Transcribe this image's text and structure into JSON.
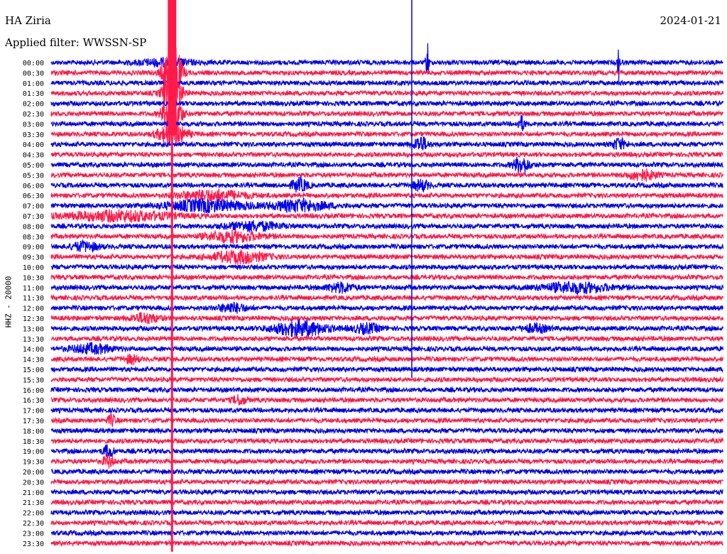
{
  "header": {
    "station": "HA Ziria",
    "date": "2024-01-21",
    "filter_text": "Applied filter: WWSSN-SP"
  },
  "axis": {
    "channel_label": "HHZ - 20000"
  },
  "colors": {
    "series_a": "#0000ee",
    "series_b": "#ff1a4a",
    "text": "#000000",
    "background": "#ffffff"
  },
  "chart_data": {
    "type": "line",
    "title": "HA Ziria",
    "ylabel": "HHZ - 20000",
    "grid": false,
    "row_labels": [
      "00:00",
      "00:30",
      "01:00",
      "01:30",
      "02:00",
      "02:30",
      "03:00",
      "03:30",
      "04:00",
      "04:30",
      "05:00",
      "05:30",
      "06:00",
      "06:30",
      "07:00",
      "07:30",
      "08:00",
      "08:30",
      "09:00",
      "09:30",
      "10:00",
      "10:30",
      "11:00",
      "11:30",
      "12:00",
      "12:30",
      "13:00",
      "13:30",
      "14:00",
      "14:30",
      "15:00",
      "15:30",
      "16:00",
      "16:30",
      "17:00",
      "17:30",
      "18:00",
      "18:30",
      "19:00",
      "19:30",
      "20:00",
      "20:30",
      "21:00",
      "21:30",
      "22:00",
      "22:30",
      "23:00",
      "23:30"
    ],
    "events": [
      {
        "row": 0,
        "x_frac": 0.17,
        "amp": 0.9,
        "width": 0.04
      },
      {
        "row": 0,
        "x_frac": 0.56,
        "amp": 6.0,
        "width": 0.002
      },
      {
        "row": 0,
        "x_frac": 0.845,
        "amp": 5.0,
        "width": 0.002
      },
      {
        "row": 1,
        "x_frac": 0.18,
        "amp": 10.0,
        "width": 0.012
      },
      {
        "row": 3,
        "x_frac": 0.18,
        "amp": 8.0,
        "width": 0.012
      },
      {
        "row": 5,
        "x_frac": 0.18,
        "amp": 8.0,
        "width": 0.012
      },
      {
        "row": 6,
        "x_frac": 0.7,
        "amp": 2.0,
        "width": 0.005
      },
      {
        "row": 7,
        "x_frac": 0.18,
        "amp": 3.0,
        "width": 0.02
      },
      {
        "row": 8,
        "x_frac": 0.55,
        "amp": 2.0,
        "width": 0.01
      },
      {
        "row": 8,
        "x_frac": 0.845,
        "amp": 1.5,
        "width": 0.01
      },
      {
        "row": 10,
        "x_frac": 0.7,
        "amp": 2.2,
        "width": 0.012
      },
      {
        "row": 11,
        "x_frac": 0.88,
        "amp": 1.4,
        "width": 0.02
      },
      {
        "row": 12,
        "x_frac": 0.37,
        "amp": 1.8,
        "width": 0.012
      },
      {
        "row": 12,
        "x_frac": 0.55,
        "amp": 1.4,
        "width": 0.012
      },
      {
        "row": 13,
        "x_frac": 0.24,
        "amp": 1.3,
        "width": 0.05
      },
      {
        "row": 14,
        "x_frac": 0.23,
        "amp": 1.5,
        "width": 0.06
      },
      {
        "row": 14,
        "x_frac": 0.37,
        "amp": 1.5,
        "width": 0.04
      },
      {
        "row": 15,
        "x_frac": 0.1,
        "amp": 1.3,
        "width": 0.08
      },
      {
        "row": 16,
        "x_frac": 0.3,
        "amp": 1.2,
        "width": 0.04
      },
      {
        "row": 17,
        "x_frac": 0.27,
        "amp": 1.4,
        "width": 0.04
      },
      {
        "row": 18,
        "x_frac": 0.05,
        "amp": 1.2,
        "width": 0.02
      },
      {
        "row": 19,
        "x_frac": 0.28,
        "amp": 1.6,
        "width": 0.04
      },
      {
        "row": 22,
        "x_frac": 0.78,
        "amp": 1.3,
        "width": 0.05
      },
      {
        "row": 22,
        "x_frac": 0.43,
        "amp": 1.2,
        "width": 0.02
      },
      {
        "row": 24,
        "x_frac": 0.27,
        "amp": 1.2,
        "width": 0.02
      },
      {
        "row": 25,
        "x_frac": 0.14,
        "amp": 1.3,
        "width": 0.02
      },
      {
        "row": 26,
        "x_frac": 0.37,
        "amp": 2.0,
        "width": 0.04
      },
      {
        "row": 26,
        "x_frac": 0.47,
        "amp": 1.2,
        "width": 0.02
      },
      {
        "row": 26,
        "x_frac": 0.72,
        "amp": 1.0,
        "width": 0.02
      },
      {
        "row": 28,
        "x_frac": 0.06,
        "amp": 1.2,
        "width": 0.03
      },
      {
        "row": 29,
        "x_frac": 0.12,
        "amp": 1.1,
        "width": 0.01
      },
      {
        "row": 33,
        "x_frac": 0.28,
        "amp": 1.2,
        "width": 0.01
      },
      {
        "row": 35,
        "x_frac": 0.09,
        "amp": 1.5,
        "width": 0.006
      },
      {
        "row": 38,
        "x_frac": 0.085,
        "amp": 1.6,
        "width": 0.008
      },
      {
        "row": 39,
        "x_frac": 0.085,
        "amp": 1.6,
        "width": 0.008
      }
    ],
    "spike_lines": [
      {
        "x_frac": 0.18,
        "from_row": 0,
        "to_row": 47,
        "color": "series_b"
      },
      {
        "x_frac": 0.537,
        "from_row": 0,
        "to_row": 30,
        "color": "series_a"
      }
    ]
  }
}
